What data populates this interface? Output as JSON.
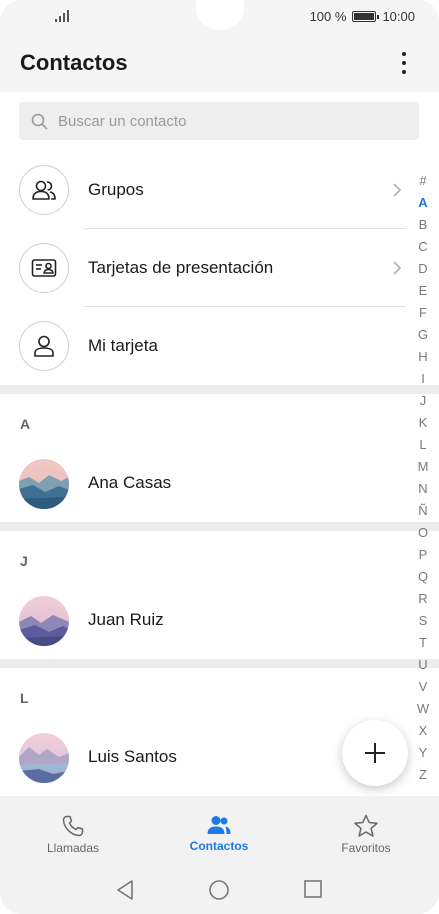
{
  "status_bar": {
    "battery_text": "100 %",
    "time": "10:00"
  },
  "header": {
    "title": "Contactos",
    "more_icon": "more-vertical-icon"
  },
  "search": {
    "placeholder": "Buscar un contacto",
    "icon": "search-icon"
  },
  "menu": [
    {
      "label": "Grupos",
      "icon": "group-icon",
      "has_chevron": true
    },
    {
      "label": "Tarjetas de presentación",
      "icon": "business-card-icon",
      "has_chevron": true
    },
    {
      "label": "Mi tarjeta",
      "icon": "person-icon",
      "has_chevron": false
    }
  ],
  "sections": [
    {
      "letter": "A",
      "contacts": [
        {
          "name": "Ana Casas"
        }
      ]
    },
    {
      "letter": "J",
      "contacts": [
        {
          "name": "Juan Ruiz"
        }
      ]
    },
    {
      "letter": "L",
      "contacts": [
        {
          "name": "Luis Santos"
        }
      ]
    }
  ],
  "alphabet_index": {
    "letters": [
      "#",
      "A",
      "B",
      "C",
      "D",
      "E",
      "F",
      "G",
      "H",
      "I",
      "J",
      "K",
      "L",
      "M",
      "N",
      "Ñ",
      "O",
      "P",
      "Q",
      "R",
      "S",
      "T",
      "U",
      "V",
      "W",
      "X",
      "Y",
      "Z"
    ],
    "active": "A"
  },
  "fab": {
    "icon": "plus-icon"
  },
  "bottom_nav": {
    "items": [
      {
        "label": "Llamadas",
        "icon": "phone-icon",
        "active": false
      },
      {
        "label": "Contactos",
        "icon": "contacts-icon",
        "active": true
      },
      {
        "label": "Favoritos",
        "icon": "star-icon",
        "active": false
      }
    ]
  },
  "system_nav": {
    "back_icon": "back-triangle-icon",
    "home_icon": "home-circle-icon",
    "recents_icon": "recents-square-icon"
  },
  "colors": {
    "accent": "#1e7be6",
    "background": "#ffffff",
    "bars": "#f2f2f2"
  }
}
